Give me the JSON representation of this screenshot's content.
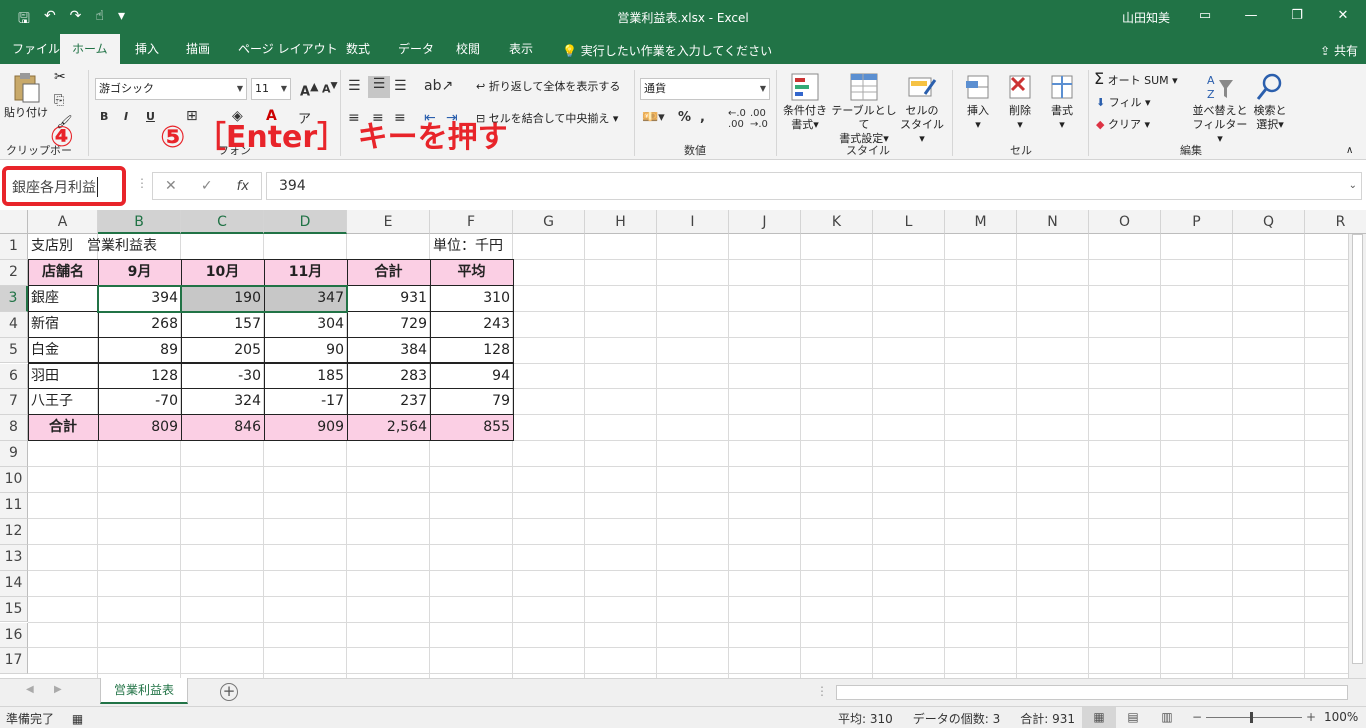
{
  "window": {
    "title": "営業利益表.xlsx  -  Excel",
    "user": "山田知美"
  },
  "tabs": [
    "ファイル",
    "ホーム",
    "挿入",
    "描画",
    "ページ レイアウト",
    "数式",
    "データ",
    "校閲",
    "表示"
  ],
  "tell_me": "実行したい作業を入力してください",
  "share": "共有",
  "ribbon": {
    "paste": "貼り付け",
    "clipboard_group": "クリップボー",
    "font_group": "フォン",
    "font_name": "游ゴシック",
    "font_size": "11",
    "bold": "B",
    "italic": "I",
    "underline": "U",
    "wrap_text": "折り返して全体を表示する",
    "merge_center": "セルを結合して中央揃え",
    "number_format": "通貨",
    "number_group": "数値",
    "percent": "%",
    "cond_format": "条件付き\n書式",
    "cond_format_1": "条件付き",
    "cond_format_2": "書式",
    "table_format_1": "テーブルとして",
    "table_format_2": "書式設定",
    "cell_style_1": "セルの",
    "cell_style_2": "スタイル",
    "style_group": "スタイル",
    "insert": "挿入",
    "delete": "削除",
    "format": "書式",
    "cells_group": "セル",
    "autosum": "オート SUM",
    "fill": "フィル",
    "clear": "クリア",
    "sort_1": "並べ替えと",
    "sort_2": "フィルター",
    "find_1": "検索と",
    "find_2": "選択",
    "edit_group": "編集"
  },
  "annotations": {
    "step4": "④",
    "step5": "⑤ ［Enter］ キーを押す"
  },
  "formula_bar": {
    "name_box": "銀座各月利益",
    "fx": "fx",
    "value": "394"
  },
  "columns": [
    "A",
    "B",
    "C",
    "D",
    "E",
    "F",
    "G",
    "H",
    "I",
    "J",
    "K",
    "L",
    "M",
    "N",
    "O",
    "P",
    "Q",
    "R"
  ],
  "rows": [
    "1",
    "2",
    "3",
    "4",
    "5",
    "6",
    "7",
    "8",
    "9",
    "10",
    "11",
    "12",
    "13",
    "14",
    "15",
    "16",
    "17"
  ],
  "sheet": {
    "a1": "支店別　営業利益表",
    "f1": "単位：千円",
    "headers": [
      "店舗名",
      "9月",
      "10月",
      "11月",
      "合計",
      "平均"
    ],
    "data": [
      [
        "銀座",
        "394",
        "190",
        "347",
        "931",
        "310"
      ],
      [
        "新宿",
        "268",
        "157",
        "304",
        "729",
        "243"
      ],
      [
        "白金",
        "89",
        "205",
        "90",
        "384",
        "128"
      ],
      [
        "羽田",
        "128",
        "-30",
        "185",
        "283",
        "94"
      ],
      [
        "八王子",
        "-70",
        "324",
        "-17",
        "237",
        "79"
      ]
    ],
    "total": [
      "合計",
      "809",
      "846",
      "909",
      "2,564",
      "855"
    ]
  },
  "sheet_tab": "営業利益表",
  "status": {
    "ready": "準備完了",
    "average": "平均: 310",
    "count": "データの個数: 3",
    "sum": "合計: 931",
    "zoom": "100%"
  }
}
